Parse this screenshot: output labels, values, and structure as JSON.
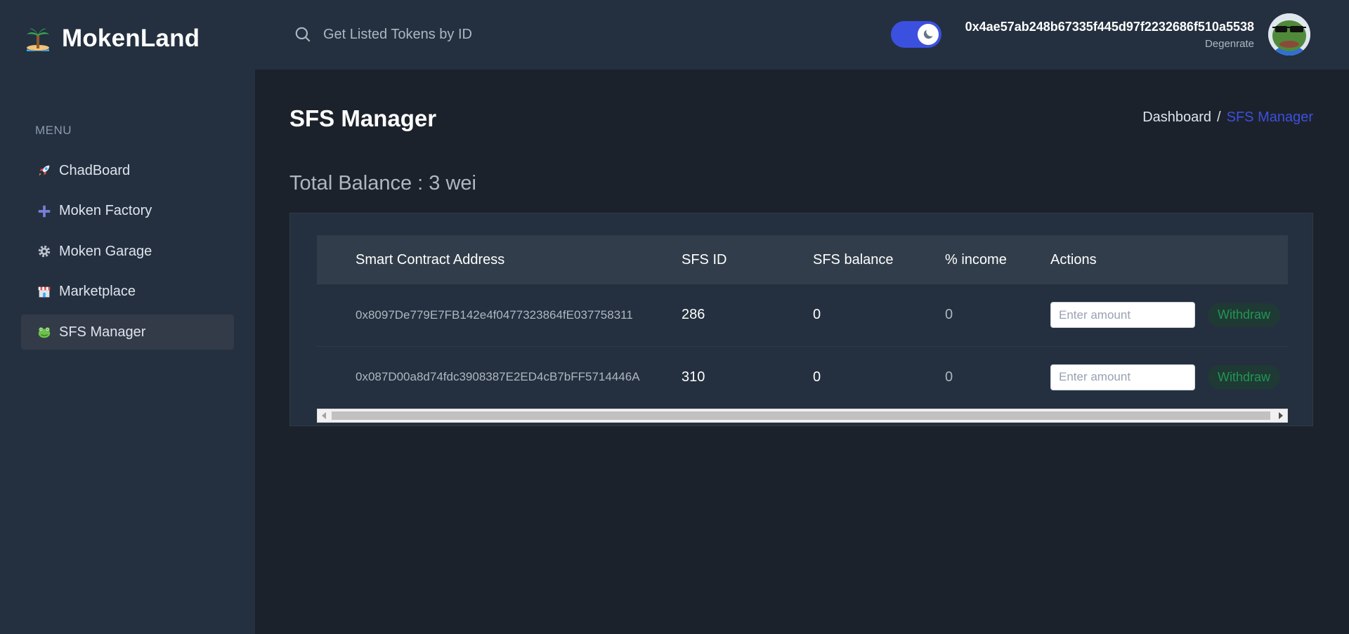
{
  "app": {
    "name": "MokenLand",
    "logo_icon": "palm-island-icon"
  },
  "search": {
    "placeholder": "Get Listed Tokens by ID",
    "icon": "search-icon"
  },
  "theme_toggle": {
    "state": "dark",
    "icon": "moon-icon",
    "accent": "#3c50e0"
  },
  "user": {
    "address": "0x4ae57ab248b67335f445d97f2232686f510a5538",
    "role": "Degenrate",
    "avatar_icon": "pepe-sunglasses-avatar"
  },
  "sidebar": {
    "menu_label": "MENU",
    "items": [
      {
        "label": "ChadBoard",
        "icon": "rocket-icon",
        "active": false
      },
      {
        "label": "Moken Factory",
        "icon": "plus-icon",
        "active": false
      },
      {
        "label": "Moken Garage",
        "icon": "gear-icon",
        "active": false
      },
      {
        "label": "Marketplace",
        "icon": "store-icon",
        "active": false
      },
      {
        "label": "SFS Manager",
        "icon": "frog-icon",
        "active": true
      }
    ]
  },
  "page": {
    "title": "SFS Manager",
    "breadcrumb": {
      "link": "Dashboard",
      "separator": "/",
      "current": "SFS Manager"
    },
    "total_balance": "Total Balance : 3 wei"
  },
  "table": {
    "headers": [
      "Smart Contract Address",
      "SFS ID",
      "SFS balance",
      "% income",
      "Actions"
    ],
    "rows": [
      {
        "address": "0x8097De779E7FB142e4f0477323864fE037758311",
        "sfs_id": "286",
        "sfs_balance": "0",
        "income": "0",
        "amount_placeholder": "Enter amount",
        "action_label": "Withdraw"
      },
      {
        "address": "0x087D00a8d74fdc3908387E2ED4cB7bFF5714446A",
        "sfs_id": "310",
        "sfs_balance": "0",
        "income": "0",
        "amount_placeholder": "Enter amount",
        "action_label": "Withdraw"
      }
    ]
  },
  "colors": {
    "sidebar_bg": "#24303f",
    "page_bg": "#1c222b",
    "accent": "#3c50e0",
    "success": "#219653"
  }
}
